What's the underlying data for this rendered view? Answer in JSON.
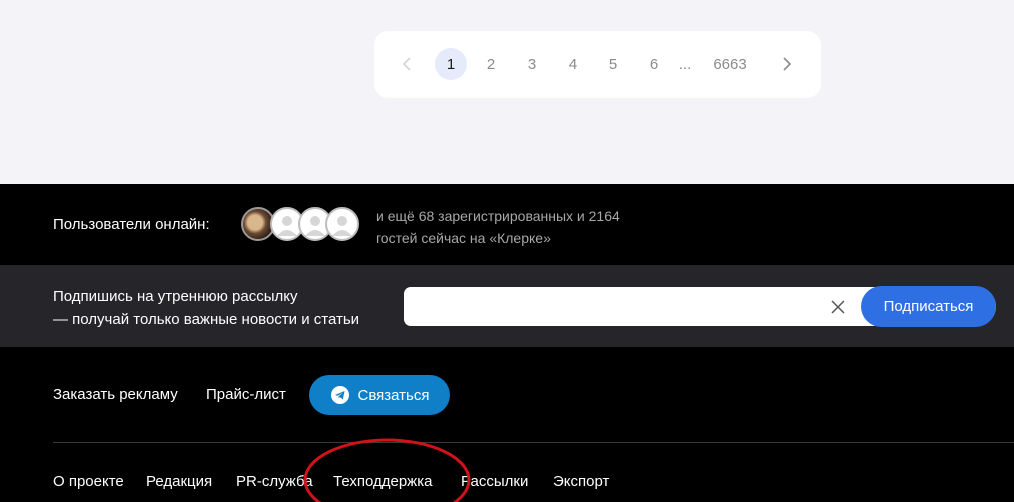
{
  "pagination": {
    "pages": [
      "1",
      "2",
      "3",
      "4",
      "5",
      "6"
    ],
    "ellipsis": "...",
    "last_page": "6663",
    "active_page": "1"
  },
  "online": {
    "label": "Пользователи онлайн:",
    "line1": "и ещё 68 зарегистрированных и 2164",
    "line2": "гостей сейчас на «Клерке»"
  },
  "newsletter": {
    "line1": "Подпишись на утреннюю рассылку",
    "line2": "— получай только важные новости и статьи",
    "input_value": "",
    "button_label": "Подписаться"
  },
  "footer": {
    "order_ad": "Заказать рекламу",
    "price_list": "Прайс-лист",
    "contact_label": "Связаться",
    "links": [
      "О проекте",
      "Редакция",
      "PR-служба",
      "Техподдержка",
      "Рассылки",
      "Экспорт"
    ]
  },
  "colors": {
    "page_bg": "#f4f4f8",
    "active_page_bg": "#e6ebfb",
    "subscribe_btn": "#2f6fe4",
    "contact_btn": "#0f7fc8",
    "annotation_circle": "#d0121a"
  }
}
